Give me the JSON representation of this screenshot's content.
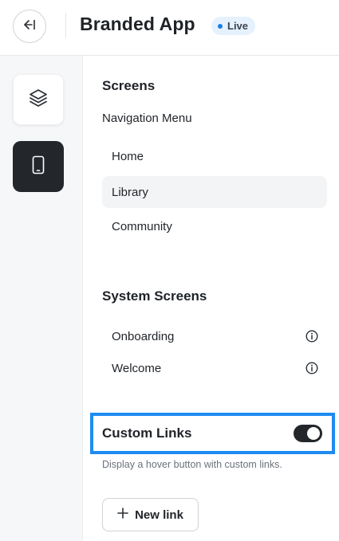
{
  "header": {
    "title": "Branded App",
    "status_badge": "Live"
  },
  "rail": {
    "items": [
      {
        "icon": "layers-icon",
        "active": false
      },
      {
        "icon": "mobile-icon",
        "active": true
      }
    ]
  },
  "screens": {
    "title": "Screens",
    "subtitle": "Navigation Menu",
    "items": [
      {
        "label": "Home",
        "selected": false
      },
      {
        "label": "Library",
        "selected": true
      },
      {
        "label": "Community",
        "selected": false
      }
    ]
  },
  "system_screens": {
    "title": "System Screens",
    "items": [
      {
        "label": "Onboarding",
        "icon": "info-icon"
      },
      {
        "label": "Welcome",
        "icon": "info-icon"
      }
    ]
  },
  "custom_links": {
    "label": "Custom Links",
    "enabled": true,
    "helper": "Display a hover button with custom links.",
    "new_link_label": "New link"
  },
  "colors": {
    "accent_highlight": "#1e8bf1",
    "live_dot": "#1a7ee6",
    "dark": "#23272c"
  }
}
